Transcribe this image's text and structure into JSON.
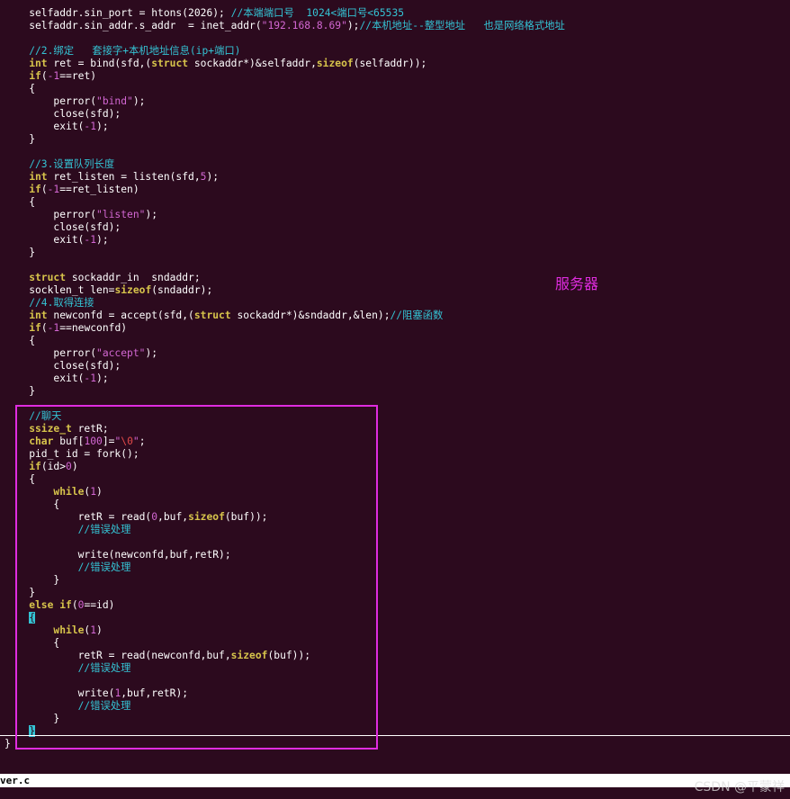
{
  "editor": {
    "lines": [
      [
        [
          "default",
          "    selfaddr.sin_port = htons(2026); "
        ],
        [
          "comment",
          "//本端端口号  1024<端口号<65535"
        ]
      ],
      [
        [
          "default",
          "    selfaddr.sin_addr.s_addr  = inet_addr("
        ],
        [
          "str",
          "\"192.168.8.69\""
        ],
        [
          "default",
          ");"
        ],
        [
          "comment",
          "//本机地址--整型地址   也是网络格式地址"
        ]
      ],
      [],
      [
        [
          "comment",
          "    //2.绑定   套接字+本机地址信息(ip+端口)"
        ]
      ],
      [
        [
          "type",
          "    int"
        ],
        [
          "default",
          " ret = bind(sfd,("
        ],
        [
          "type",
          "struct"
        ],
        [
          "default",
          " sockaddr*)&selfaddr,"
        ],
        [
          "kw",
          "sizeof"
        ],
        [
          "default",
          "(selfaddr));"
        ]
      ],
      [
        [
          "kw",
          "    if"
        ],
        [
          "default",
          "("
        ],
        [
          "num",
          "-1"
        ],
        [
          "default",
          "==ret)"
        ]
      ],
      [
        [
          "default",
          "    {"
        ]
      ],
      [
        [
          "default",
          "        perror("
        ],
        [
          "str",
          "\"bind\""
        ],
        [
          "default",
          ");"
        ]
      ],
      [
        [
          "default",
          "        close(sfd);"
        ]
      ],
      [
        [
          "default",
          "        exit("
        ],
        [
          "num",
          "-1"
        ],
        [
          "default",
          ");"
        ]
      ],
      [
        [
          "default",
          "    }"
        ]
      ],
      [],
      [
        [
          "comment",
          "    //3.设置队列长度"
        ]
      ],
      [
        [
          "type",
          "    int"
        ],
        [
          "default",
          " ret_listen = listen(sfd,"
        ],
        [
          "num",
          "5"
        ],
        [
          "default",
          ");"
        ]
      ],
      [
        [
          "kw",
          "    if"
        ],
        [
          "default",
          "("
        ],
        [
          "num",
          "-1"
        ],
        [
          "default",
          "==ret_listen)"
        ]
      ],
      [
        [
          "default",
          "    {"
        ]
      ],
      [
        [
          "default",
          "        perror("
        ],
        [
          "str",
          "\"listen\""
        ],
        [
          "default",
          ");"
        ]
      ],
      [
        [
          "default",
          "        close(sfd);"
        ]
      ],
      [
        [
          "default",
          "        exit("
        ],
        [
          "num",
          "-1"
        ],
        [
          "default",
          ");"
        ]
      ],
      [
        [
          "default",
          "    }"
        ]
      ],
      [],
      [
        [
          "type",
          "    struct"
        ],
        [
          "default",
          " sockaddr_in  sndaddr;"
        ]
      ],
      [
        [
          "default",
          "    socklen_t len="
        ],
        [
          "kw",
          "sizeof"
        ],
        [
          "default",
          "(sndaddr);"
        ]
      ],
      [
        [
          "comment",
          "    //4.取得连接"
        ]
      ],
      [
        [
          "type",
          "    int"
        ],
        [
          "default",
          " newconfd = accept(sfd,("
        ],
        [
          "type",
          "struct"
        ],
        [
          "default",
          " sockaddr*)&sndaddr,&len);"
        ],
        [
          "comment",
          "//阻塞函数"
        ]
      ],
      [
        [
          "kw",
          "    if"
        ],
        [
          "default",
          "("
        ],
        [
          "num",
          "-1"
        ],
        [
          "default",
          "==newconfd)"
        ]
      ],
      [
        [
          "default",
          "    {"
        ]
      ],
      [
        [
          "default",
          "        perror("
        ],
        [
          "str",
          "\"accept\""
        ],
        [
          "default",
          ");"
        ]
      ],
      [
        [
          "default",
          "        close(sfd);"
        ]
      ],
      [
        [
          "default",
          "        exit("
        ],
        [
          "num",
          "-1"
        ],
        [
          "default",
          ");"
        ]
      ],
      [
        [
          "default",
          "    }"
        ]
      ],
      [],
      [
        [
          "comment",
          "    //聊天"
        ]
      ],
      [
        [
          "type",
          "    ssize_t"
        ],
        [
          "default",
          " retR;"
        ]
      ],
      [
        [
          "type",
          "    char"
        ],
        [
          "default",
          " buf["
        ],
        [
          "num",
          "100"
        ],
        [
          "default",
          "]="
        ],
        [
          "str",
          "\""
        ],
        [
          "esc",
          "\\0"
        ],
        [
          "str",
          "\""
        ],
        [
          "default",
          ";"
        ]
      ],
      [
        [
          "default",
          "    pid_t id = fork();"
        ]
      ],
      [
        [
          "kw",
          "    if"
        ],
        [
          "default",
          "(id>"
        ],
        [
          "num",
          "0"
        ],
        [
          "default",
          ")"
        ]
      ],
      [
        [
          "default",
          "    {"
        ]
      ],
      [
        [
          "kw",
          "        while"
        ],
        [
          "default",
          "("
        ],
        [
          "num",
          "1"
        ],
        [
          "default",
          ")"
        ]
      ],
      [
        [
          "default",
          "        {"
        ]
      ],
      [
        [
          "default",
          "            retR = read("
        ],
        [
          "num",
          "0"
        ],
        [
          "default",
          ",buf,"
        ],
        [
          "kw",
          "sizeof"
        ],
        [
          "default",
          "(buf));"
        ]
      ],
      [
        [
          "comment",
          "            //错误处理"
        ]
      ],
      [],
      [
        [
          "default",
          "            write(newconfd,buf,retR);"
        ]
      ],
      [
        [
          "comment",
          "            //错误处理"
        ]
      ],
      [
        [
          "default",
          "        }"
        ]
      ],
      [
        [
          "default",
          "    }"
        ]
      ],
      [
        [
          "kw",
          "    else if"
        ],
        [
          "default",
          "("
        ],
        [
          "num",
          "0"
        ],
        [
          "default",
          "==id)"
        ]
      ],
      [
        [
          "default",
          "    "
        ],
        [
          "match",
          "{"
        ]
      ],
      [
        [
          "kw",
          "        while"
        ],
        [
          "default",
          "("
        ],
        [
          "num",
          "1"
        ],
        [
          "default",
          ")"
        ]
      ],
      [
        [
          "default",
          "        {"
        ]
      ],
      [
        [
          "default",
          "            retR = read(newconfd,buf,"
        ],
        [
          "kw",
          "sizeof"
        ],
        [
          "default",
          "(buf));"
        ]
      ],
      [
        [
          "comment",
          "            //错误处理"
        ]
      ],
      [],
      [
        [
          "default",
          "            write("
        ],
        [
          "num",
          "1"
        ],
        [
          "default",
          ",buf,retR);"
        ]
      ],
      [
        [
          "comment",
          "            //错误处理"
        ]
      ],
      [
        [
          "default",
          "        }"
        ]
      ],
      [
        [
          "default",
          "    "
        ],
        [
          "cursor",
          "}"
        ]
      ],
      [
        [
          "default",
          "}"
        ]
      ]
    ]
  },
  "status_bar": {
    "filename": "ver.c"
  },
  "annotation": {
    "label": "服务器"
  },
  "watermark": {
    "text": "CSDN @平蒙祥"
  }
}
